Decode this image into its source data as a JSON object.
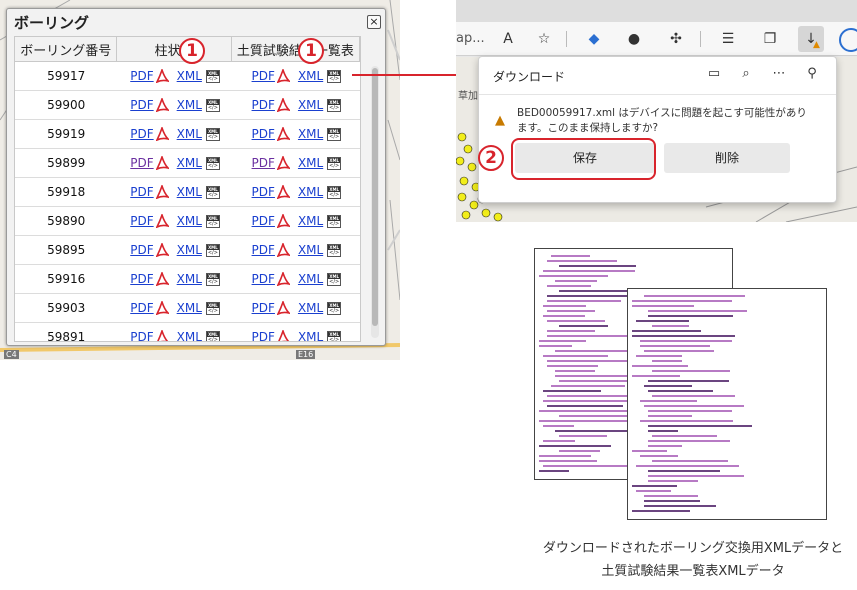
{
  "left_panel": {
    "title": "ボーリング",
    "close_glyph": "×",
    "headers": [
      "ボーリング番号",
      "柱状図",
      "土質試験結果一覧表"
    ],
    "rows": [
      {
        "id": "59917",
        "pdf1_visited": false
      },
      {
        "id": "59900",
        "pdf1_visited": false
      },
      {
        "id": "59919",
        "pdf1_visited": false
      },
      {
        "id": "59899",
        "pdf1_visited": true
      },
      {
        "id": "59918",
        "pdf1_visited": false
      },
      {
        "id": "59890",
        "pdf1_visited": false
      },
      {
        "id": "59895",
        "pdf1_visited": false
      },
      {
        "id": "59916",
        "pdf1_visited": false
      },
      {
        "id": "59903",
        "pdf1_visited": false
      },
      {
        "id": "59891",
        "pdf1_visited": false
      }
    ],
    "pdf_label": "PDF",
    "xml_label": "XML",
    "xml_icon_top": "XML",
    "xml_icon_bottom": "</>",
    "map_corner_left": "C4",
    "map_corner_right": "E16"
  },
  "badges": {
    "one": "1",
    "two": "2"
  },
  "browser": {
    "address_fragment": "ap...",
    "download_panel": {
      "title": "ダウンロード",
      "message": "BED00059917.xml はデバイスに問題を起こす可能性があります。このまま保持しますか?",
      "save_label": "保存",
      "delete_label": "削除"
    },
    "map_label": "草加"
  },
  "caption": {
    "line1": "ダウンロードされたボーリング交換用XMLデータと",
    "line2": "土質試験結果一覧表XMLデータ"
  },
  "colors": {
    "accent_red": "#d8242c",
    "link_blue": "#1a3fcf",
    "visited_purple": "#6a2fa0",
    "pdf_red": "#d8242c",
    "xml_text": "#b77ac4"
  }
}
